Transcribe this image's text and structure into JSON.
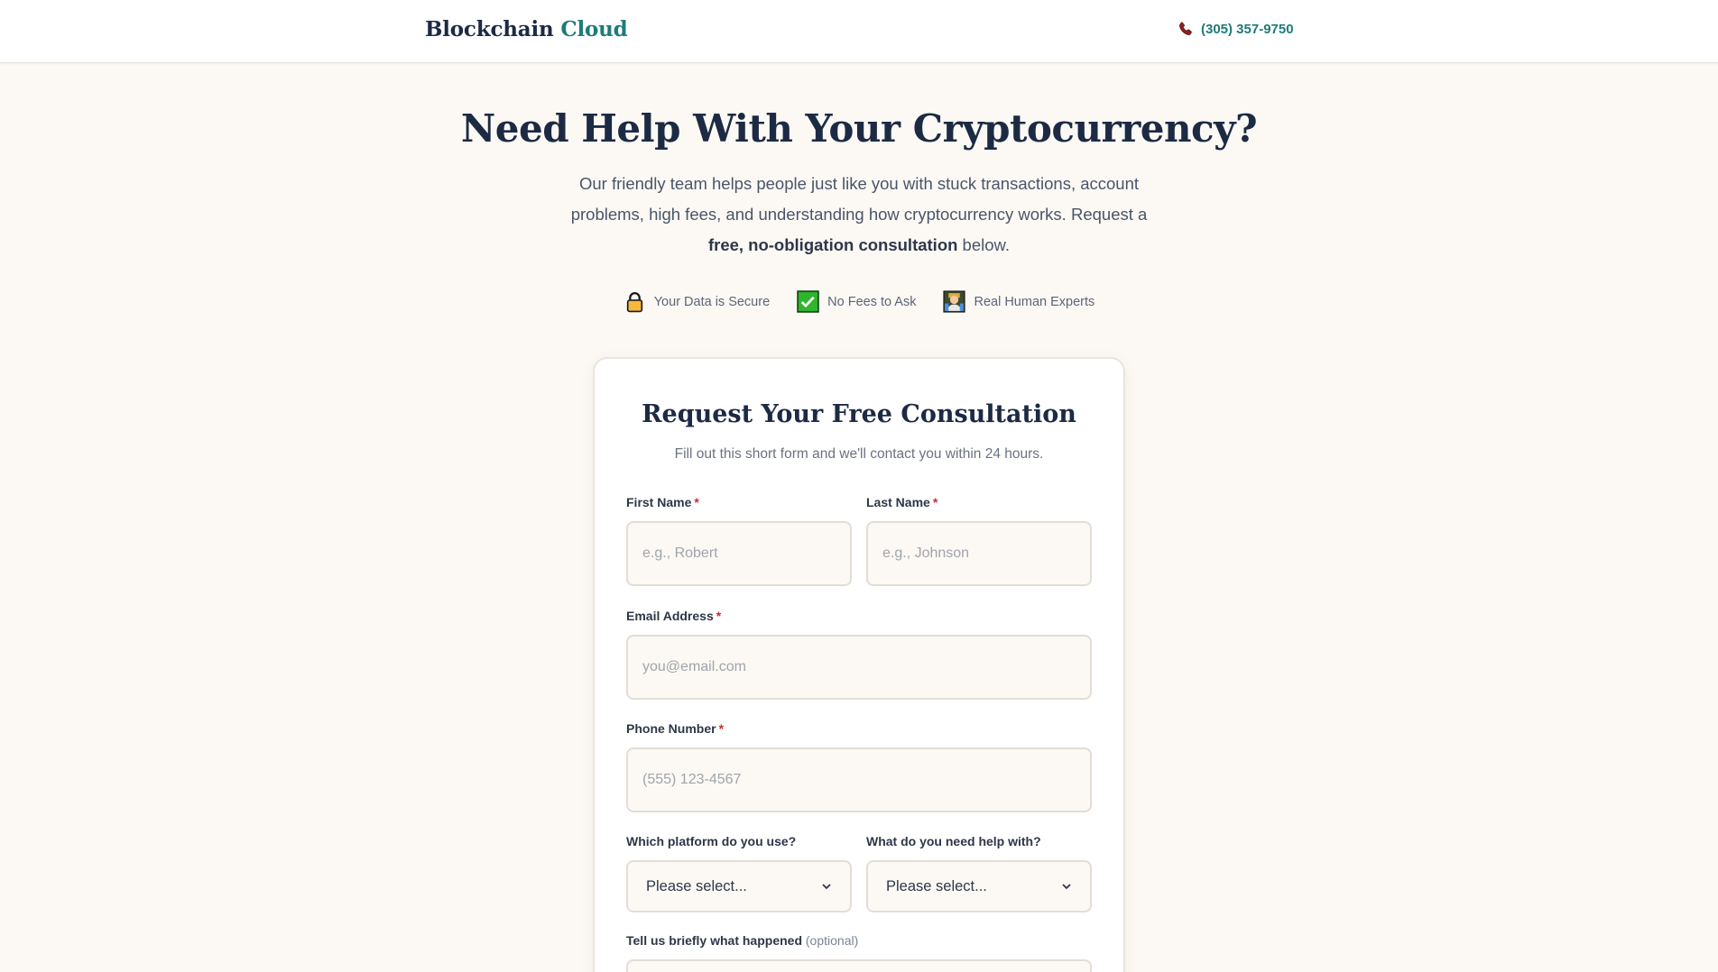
{
  "header": {
    "logo_main": "Blockchain",
    "logo_accent": "Cloud",
    "phone": "(305) 357-9750"
  },
  "hero": {
    "title": "Need Help With Your Cryptocurrency?",
    "subtitle_before": "Our friendly team helps people just like you with stuck transactions, account problems, high fees, and understanding how cryptocurrency works. Request a ",
    "subtitle_bold": "free, no-obligation consultation",
    "subtitle_after": " below."
  },
  "badges": [
    {
      "icon": "lock-icon",
      "label": "Your Data is Secure"
    },
    {
      "icon": "checkmark-icon",
      "label": "No Fees to Ask"
    },
    {
      "icon": "person-icon",
      "label": "Real Human Experts"
    }
  ],
  "form": {
    "title": "Request Your Free Consultation",
    "subtitle": "Fill out this short form and we'll contact you within 24 hours.",
    "first_name": {
      "label": "First Name",
      "required": "*",
      "placeholder": "e.g., Robert"
    },
    "last_name": {
      "label": "Last Name",
      "required": "*",
      "placeholder": "e.g., Johnson"
    },
    "email": {
      "label": "Email Address",
      "required": "*",
      "placeholder": "you@email.com"
    },
    "phone": {
      "label": "Phone Number",
      "required": "*",
      "placeholder": "(555) 123-4567"
    },
    "platform": {
      "label": "Which platform do you use?",
      "selected": "Please select..."
    },
    "help": {
      "label": "What do you need help with?",
      "selected": "Please select..."
    },
    "details": {
      "label": "Tell us briefly what happened",
      "optional": "(optional)"
    }
  },
  "colors": {
    "brand_dark": "#1c2a44",
    "brand_accent": "#1f7a7a",
    "background": "#fcf9f5",
    "required": "#c53030"
  }
}
